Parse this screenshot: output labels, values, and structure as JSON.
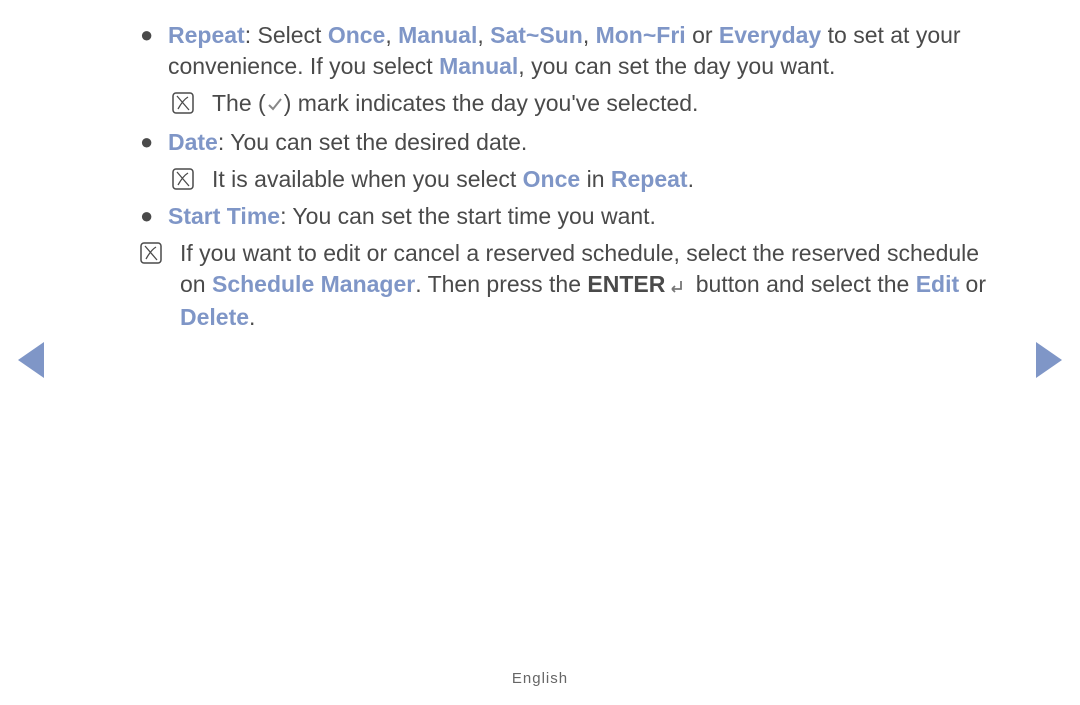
{
  "highlight_color": "#7f96c7",
  "items": {
    "repeat": {
      "label": "Repeat",
      "text_before_options": ": Select ",
      "options": [
        "Once",
        "Manual",
        "Sat~Sun",
        "Mon~Fri",
        "Everyday"
      ],
      "joiner_comma": ", ",
      "joiner_or": " or ",
      "text_after_options_1": " to set at your convenience. If you select ",
      "manual_hl": "Manual",
      "text_after_options_2": ", you can set the day you want."
    },
    "repeat_note": {
      "before": "The (",
      "after": ") mark indicates the day you've selected."
    },
    "date": {
      "label": "Date",
      "text": ": You can set the desired date."
    },
    "date_note": {
      "before": "It is available when you select ",
      "hl1": "Once",
      "mid": " in ",
      "hl2": "Repeat",
      "after": "."
    },
    "start_time": {
      "label": "Start Time",
      "text": ": You can set the start time you want."
    },
    "final_note": {
      "seg1": "If you want to edit or cancel a reserved schedule, select the reserved schedule on ",
      "hl1": "Schedule Manager",
      "seg2": ". Then press the ",
      "bold1": "ENTER",
      "seg3": " button and select the ",
      "hl2": "Edit",
      "seg4": " or ",
      "hl3": "Delete",
      "seg5": "."
    }
  },
  "footer": "English"
}
